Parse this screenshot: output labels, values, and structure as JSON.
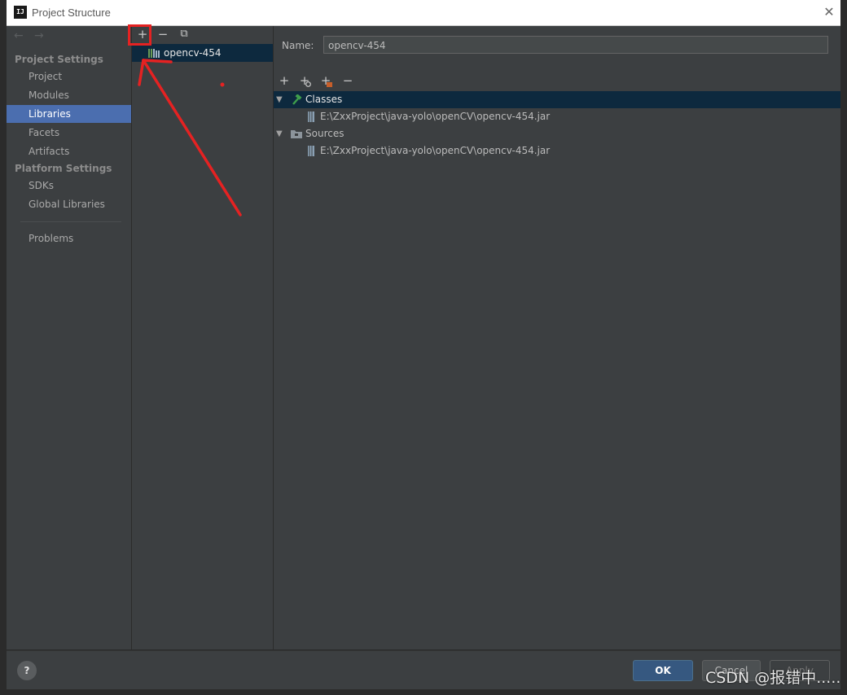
{
  "window": {
    "title": "Project Structure",
    "app_icon_text": "IJ",
    "close_symbol": "✕"
  },
  "nav": {
    "back_symbol": "←",
    "forward_symbol": "→",
    "project_settings_header": "Project Settings",
    "platform_settings_header": "Platform Settings",
    "items": {
      "project": "Project",
      "modules": "Modules",
      "libraries": "Libraries",
      "facets": "Facets",
      "artifacts": "Artifacts",
      "sdks": "SDKs",
      "global_libraries": "Global Libraries",
      "problems": "Problems"
    },
    "selected": "Libraries"
  },
  "libraries_panel": {
    "toolbar": {
      "add": "+",
      "remove": "−",
      "copy": "⧉"
    },
    "items": [
      {
        "name": "opencv-454"
      }
    ]
  },
  "detail": {
    "name_label": "Name:",
    "name_value": "opencv-454",
    "toolbar": {
      "add": "+",
      "add_special": "+",
      "add_alt": "+",
      "remove": "−"
    },
    "tree": {
      "classes_label": "Classes",
      "classes_path": "E:\\ZxxProject\\java-yolo\\openCV\\opencv-454.jar",
      "sources_label": "Sources",
      "sources_path": "E:\\ZxxProject\\java-yolo\\openCV\\opencv-454.jar"
    }
  },
  "footer": {
    "help": "?",
    "ok": "OK",
    "cancel": "Cancel",
    "apply": "Apply"
  },
  "watermark": "CSDN @报错中.....",
  "icons": [
    "app-logo-icon",
    "close-icon",
    "back-arrow-icon",
    "forward-arrow-icon",
    "library-icon",
    "hammer-icon",
    "folder-icon",
    "jar-icon",
    "collapse-triangle-icon",
    "help-icon"
  ],
  "colors": {
    "selection": "#4b6eaf",
    "tree_selection": "#0d293e",
    "annotation": "#e52222",
    "ok_button": "#365880"
  }
}
